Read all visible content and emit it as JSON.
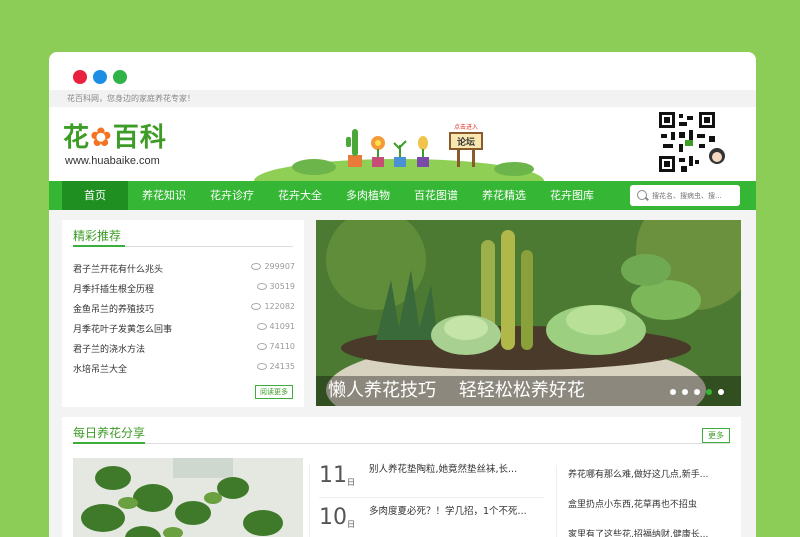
{
  "window_controls": [
    "close",
    "minimize",
    "maximize"
  ],
  "infobar": {
    "text": "花百科网，您身边的家庭养花专家！"
  },
  "logo": {
    "brand": "花",
    "flower": "✿",
    "brand2": "百科",
    "url": "www.huabaike.com"
  },
  "banner": {
    "sign_hint": "点击进入",
    "sign_label": "论坛"
  },
  "nav": {
    "items": [
      "首页",
      "养花知识",
      "花卉诊疗",
      "花卉大全",
      "多肉植物",
      "百花图谱",
      "养花精选",
      "花卉图库"
    ],
    "active_index": 0
  },
  "search": {
    "placeholder": "搜花名、搜病虫、搜..."
  },
  "recommend": {
    "title": "精彩推荐",
    "items": [
      {
        "title": "君子兰开花有什么兆头",
        "views": "299907"
      },
      {
        "title": "月季扦插生根全历程",
        "views": "30519"
      },
      {
        "title": "金鱼吊兰的养殖技巧",
        "views": "122082"
      },
      {
        "title": "月季花叶子发黄怎么回事",
        "views": "41091"
      },
      {
        "title": "君子兰的浇水方法",
        "views": "74110"
      },
      {
        "title": "水培吊兰大全",
        "views": "24135"
      }
    ],
    "more_label": "阅读更多"
  },
  "slider": {
    "caption": "懒人养花技巧    轻轻松松养好花",
    "dots": 5,
    "active_dot": 3
  },
  "share": {
    "title": "每日养花分享",
    "more_label": "更多",
    "date_items": [
      {
        "day": "11",
        "unit": "日",
        "title": "别人养花垫陶粒,她竟然垫丝袜,长..."
      },
      {
        "day": "10",
        "unit": "日",
        "title": "多肉度夏必死？！学几招，1个不死..."
      }
    ],
    "right_items": [
      "养花哪有那么难,做好这几点,新手...",
      "盒里扔点小东西,花草再也不招虫",
      "家里有了这些花,招福纳财,健康长..."
    ]
  },
  "colors": {
    "background": "#8ccd57",
    "nav": "#35b735",
    "nav_active": "#1f8f22",
    "accent": "#3c9c25"
  }
}
